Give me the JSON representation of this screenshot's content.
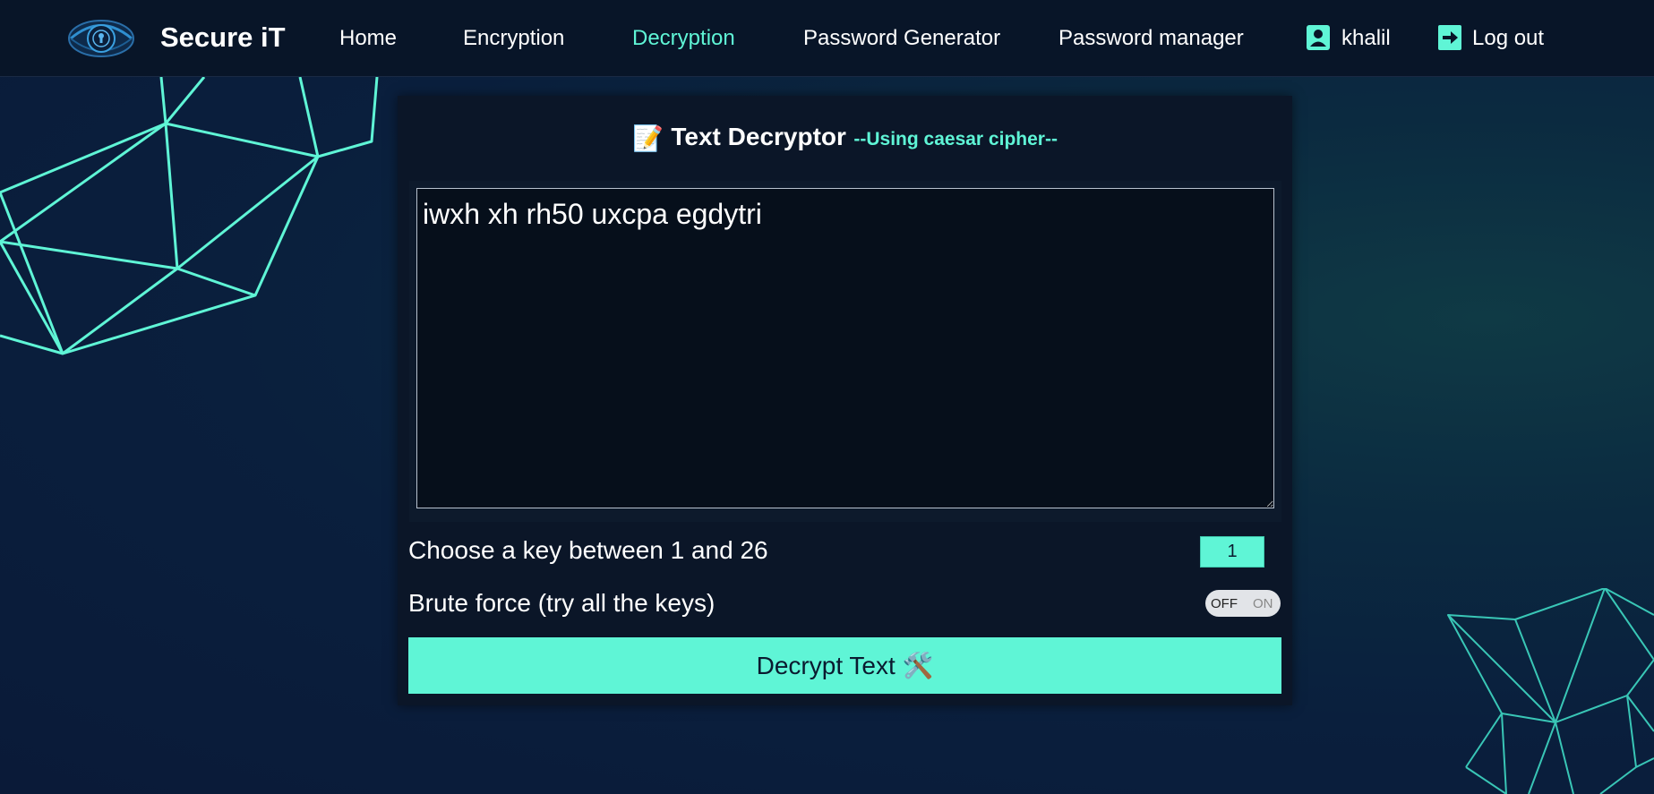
{
  "colors": {
    "accent": "#5ff5d6",
    "navbar_bg": "#081528",
    "panel_bg": "#0b1628"
  },
  "navbar": {
    "brand": "Secure iT",
    "links": [
      "Home",
      "Encryption",
      "Decryption",
      "Password Generator",
      "Password manager"
    ],
    "active_link": "Decryption",
    "user": {
      "icon": "user-icon",
      "name": "khalil"
    },
    "logout": {
      "icon": "logout-icon",
      "label": "Log out"
    }
  },
  "panel": {
    "title_icon": "memo-icon",
    "title": "Text Decryptor",
    "subtitle": "--Using caesar cipher--",
    "textarea_value": "iwxh xh rh50 uxcpa egdytri",
    "key_label": "Choose a key between 1 and 26",
    "key_value": "1",
    "brute_label": "Brute force (try all the keys)",
    "toggle_off": "OFF",
    "toggle_on": "ON",
    "toggle_state": "OFF",
    "button_label": "Decrypt Text",
    "button_icon": "hammer-wrench-icon"
  }
}
